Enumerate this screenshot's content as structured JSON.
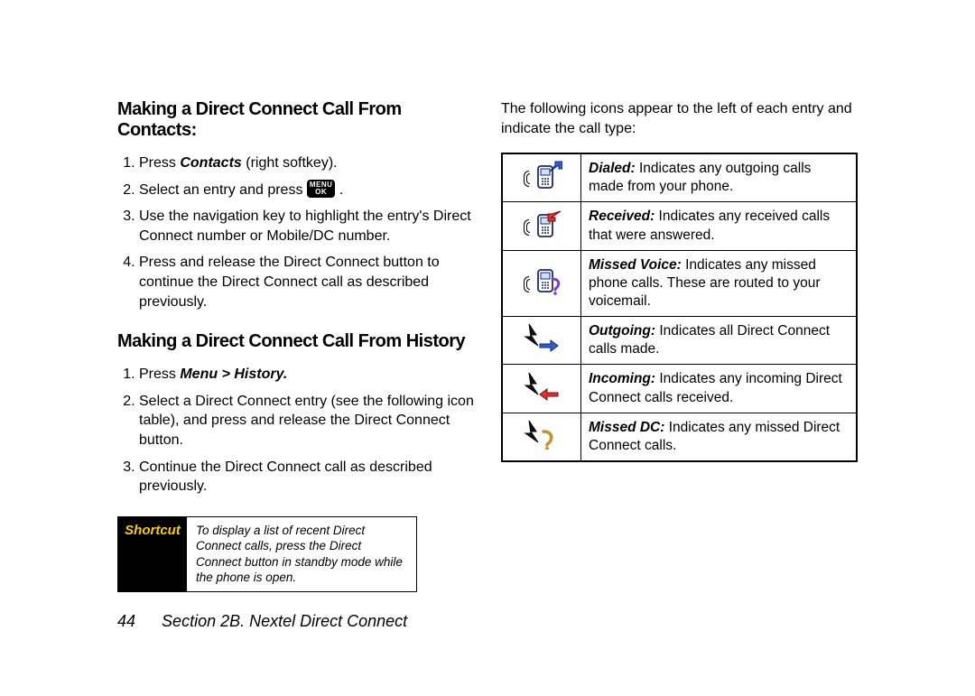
{
  "left": {
    "h1": "Making a Direct Connect Call From Contacts:",
    "steps1": {
      "s1_a": "Press ",
      "s1_b": "Contacts",
      "s1_c": " (right softkey).",
      "s2_a": "Select an entry and press ",
      "s2_c": ".",
      "s3": "Use the navigation key to highlight the entry's Direct Connect number or Mobile/DC number.",
      "s4": "Press and release the Direct Connect button to continue the Direct Connect call as described previously."
    },
    "h2": "Making a Direct Connect Call From History",
    "steps2": {
      "s1_a": "Press ",
      "s1_b": "Menu > History.",
      "s2": "Select a Direct Connect entry (see the following icon table), and press and release the Direct Connect button.",
      "s3": "Continue the Direct Connect call as described previously."
    },
    "shortcut_label": "Shortcut",
    "shortcut_text": "To display a list of recent Direct Connect calls, press the Direct Connect button in standby mode while the phone is open."
  },
  "right": {
    "lead": "The following icons appear to the left of each entry and indicate the call type:",
    "rows": {
      "r0": {
        "name": "Dialed:",
        "desc": " Indicates any outgoing calls made from your phone."
      },
      "r1": {
        "name": "Received:",
        "desc": " Indicates any received calls that were answered."
      },
      "r2": {
        "name": "Missed Voice:",
        "desc": " Indicates any missed phone calls. These are routed to your voicemail."
      },
      "r3": {
        "name": "Outgoing:",
        "desc": " Indicates all Direct Connect calls made."
      },
      "r4": {
        "name": "Incoming:",
        "desc": " Indicates any incoming Direct Connect calls received."
      },
      "r5": {
        "name": "Missed DC:",
        "desc": " Indicates any missed Direct Connect calls."
      }
    }
  },
  "menu_key": {
    "l1": "MENU",
    "l2": "OK"
  },
  "footer": {
    "page": "44",
    "section": "Section 2B. Nextel Direct Connect"
  }
}
